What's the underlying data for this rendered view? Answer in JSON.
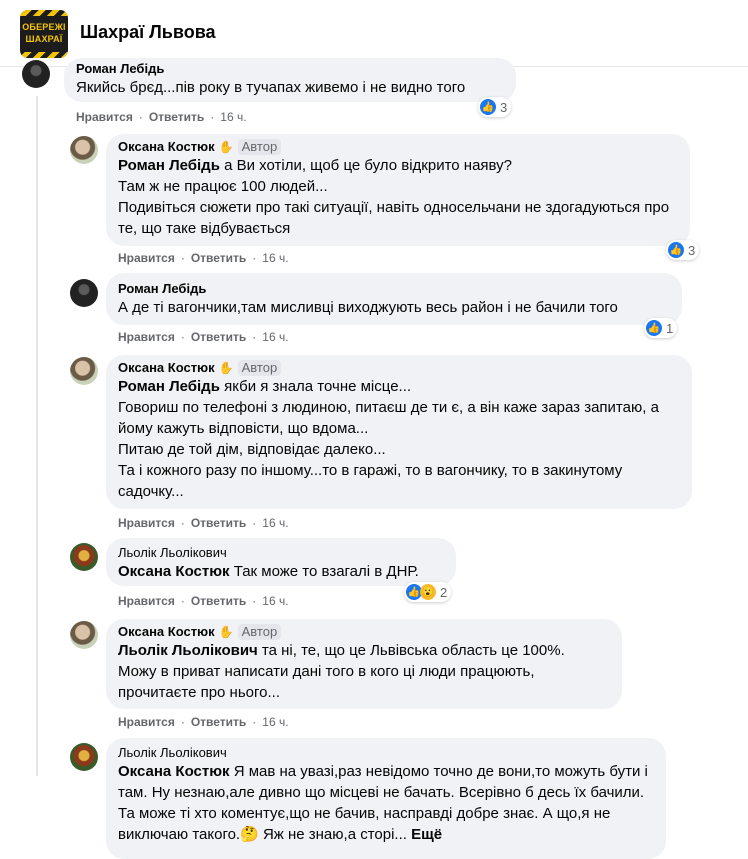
{
  "header": {
    "group_name": "Шахраї Львова",
    "logo_line1": "ОБЕРЕЖІ",
    "logo_line2": "ШАХРАЇ"
  },
  "labels": {
    "like": "Нравится",
    "reply": "Ответить",
    "separator": "·",
    "author_badge": "Автор",
    "more": "Ещё"
  },
  "comments": [
    {
      "author": "Роман Лебідь",
      "mention": "",
      "text": "Якийсь брєд...пів року в тучапах живемо і не видно того",
      "time": "16 ч.",
      "reactions": "3",
      "is_author": false
    },
    {
      "author": "Оксана Костюк",
      "mention": "Роман Лебідь",
      "text": " а Ви хотіли, щоб це було відкрито наяву?\nТам ж не працює 100 людей...\nПодивіться сюжети про такі ситуації, навіть односельчани не здогадуються про те, що таке відбувається",
      "time": "16 ч.",
      "reactions": "3",
      "is_author": true
    },
    {
      "author": "Роман Лебідь",
      "mention": "",
      "text": "А де ті вагончики,там мисливці виходжують весь район і не бачили того",
      "time": "16 ч.",
      "reactions": "1",
      "is_author": false
    },
    {
      "author": "Оксана Костюк",
      "mention": "Роман Лебідь",
      "text": " якби я знала точне місце...\nГовориш по телефоні з людиною, питаєш де ти є, а він каже зараз запитаю, а йому кажуть відповісти, що вдома...\nПитаю де той дім, відповідає далеко...\nТа і кожного разу по іншому...то в гаражі, то в вагончику, то в закинутому садочку...",
      "time": "16 ч.",
      "reactions": "",
      "is_author": true
    },
    {
      "author": "Льолік Льолікович",
      "mention": "Оксана Костюк",
      "text": " Так може то взагалі в ДНР.",
      "time": "16 ч.",
      "reactions": "2",
      "is_author": false
    },
    {
      "author": "Оксана Костюк",
      "mention": "Льолік Льолікович",
      "text": " та ні, те, що це Львівська область це 100%.\nМожу в приват написати дані того в кого ці люди працюють, прочитаєте про нього...",
      "time": "16 ч.",
      "reactions": "",
      "is_author": true
    },
    {
      "author": "Льолік Льолікович",
      "mention": "Оксана Костюк",
      "text": " Я мав на увазі,раз невідомо точно де вони,то можуть бути і там. Ну незнаю,але дивно що місцеві не бачать. Всерівно б десь їх бачили. Та може ті хто коментує,що не бачив, насправді добре знає. А що,я не виключаю такого.🤔 Яж не знаю,а сторі...",
      "time": "",
      "reactions": "",
      "is_author": false
    }
  ],
  "colors": {
    "bubble": "#f0f2f5",
    "like": "#1877f2",
    "meta": "#65676b"
  }
}
